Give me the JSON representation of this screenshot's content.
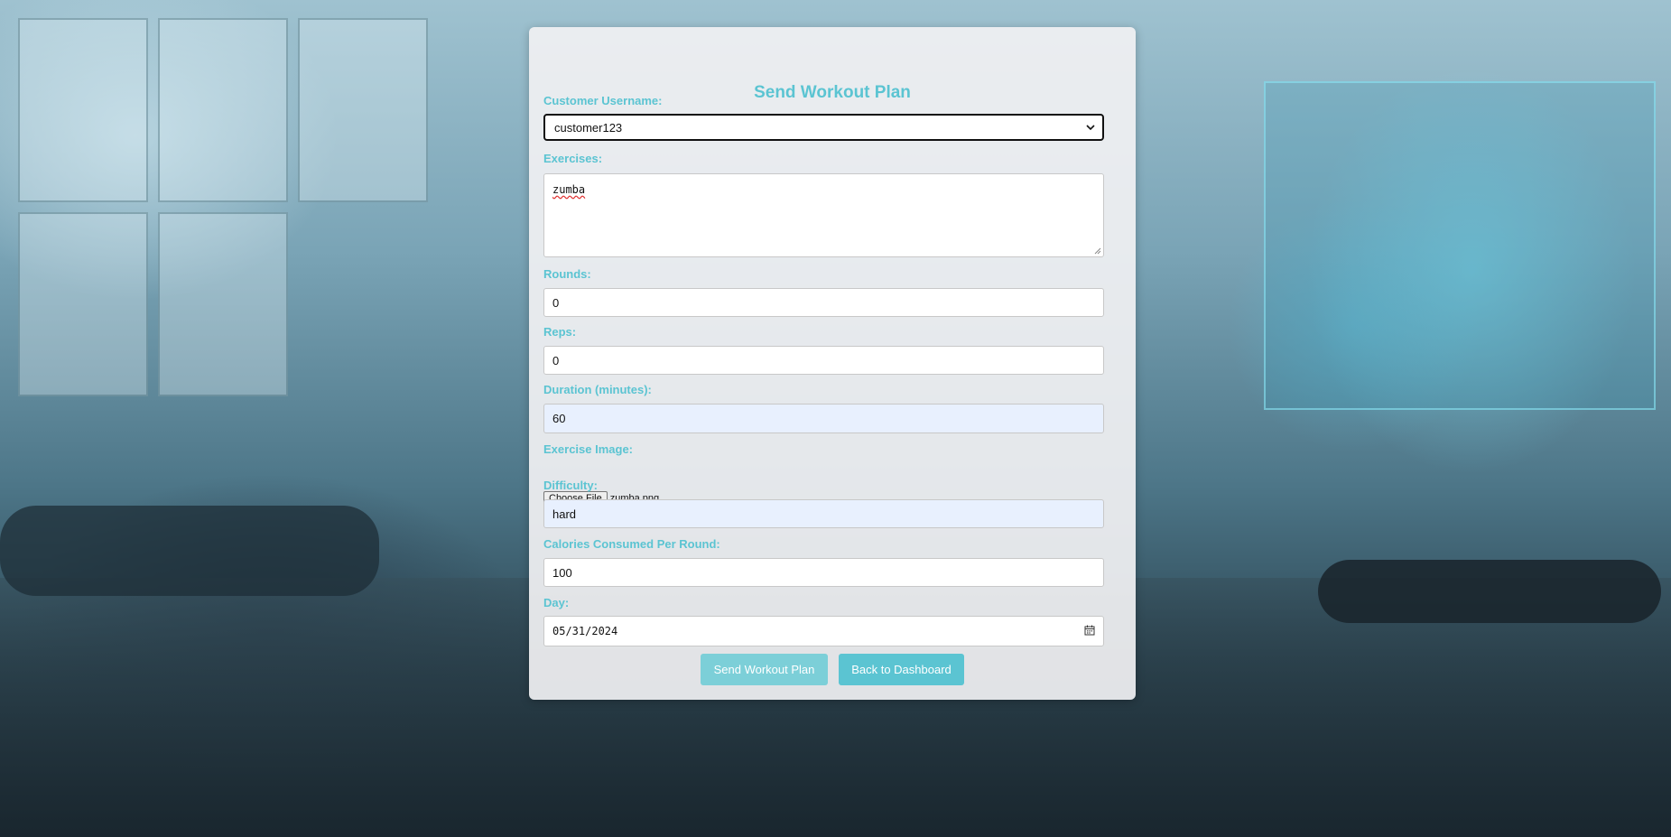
{
  "form": {
    "title": "Send Workout Plan",
    "customer_username": {
      "label": "Customer Username:",
      "selected": "customer123"
    },
    "exercises": {
      "label": "Exercises:",
      "value": "zumba"
    },
    "rounds": {
      "label": "Rounds:",
      "value": "0"
    },
    "reps": {
      "label": "Reps:",
      "value": "0"
    },
    "duration": {
      "label": "Duration (minutes):",
      "value": "60"
    },
    "exercise_image": {
      "label": "Exercise Image:",
      "button_label": "Choose File",
      "file_name": "zumba.png"
    },
    "difficulty": {
      "label": "Difficulty:",
      "value": "hard"
    },
    "calories": {
      "label": "Calories Consumed Per Round:",
      "value": "100"
    },
    "day": {
      "label": "Day:",
      "value": "05/31/2024"
    }
  },
  "actions": {
    "send_label": "Send Workout Plan",
    "back_label": "Back to Dashboard"
  },
  "colors": {
    "accent": "#5bc4d2",
    "send_button": "#7ccfd8",
    "back_button": "#5bc4d2",
    "autofill_background": "#e8f0fe"
  },
  "icons": {
    "select_arrow": "chevron-down-icon",
    "date_picker": "calendar-icon"
  }
}
